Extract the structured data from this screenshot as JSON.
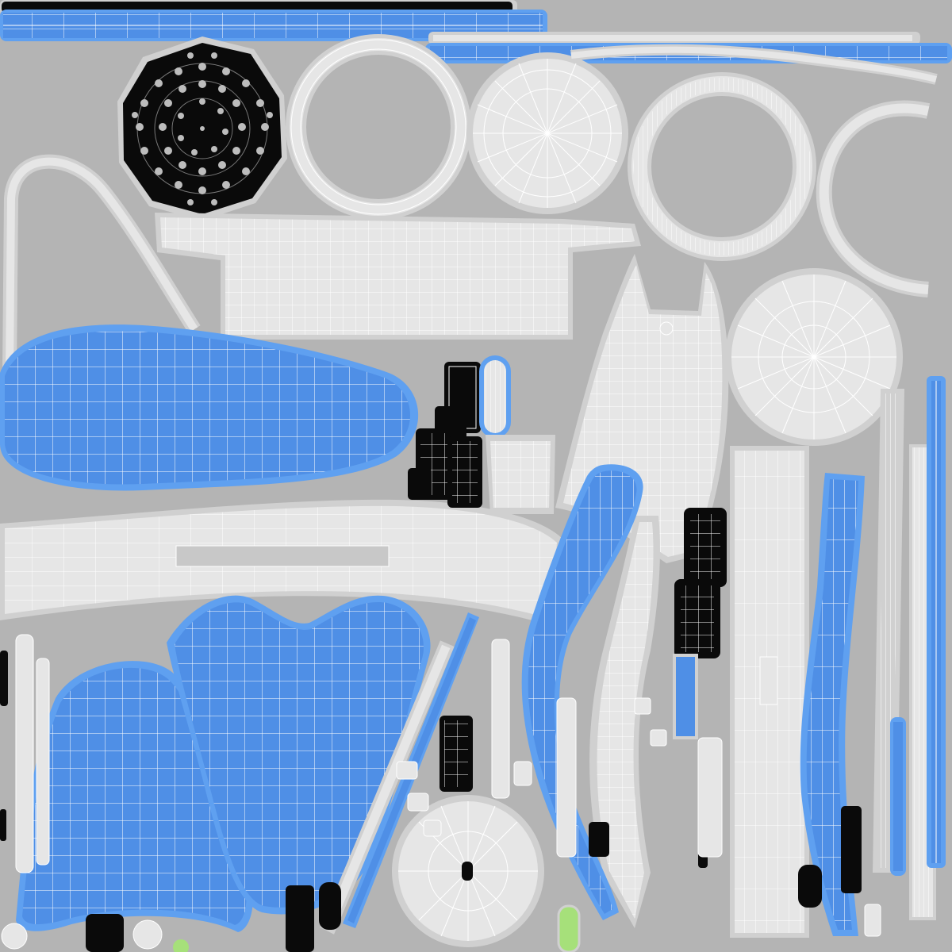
{
  "canvas": {
    "background": "#b4b4b4"
  },
  "palette": {
    "island_fill": "#e6e6e6",
    "island_halo": "#d0d0d0",
    "wire": "#ffffff",
    "blue_fill": "#4f8fe6",
    "blue_halo": "#5fa0f0",
    "black_fill": "#0a0a0a",
    "green_fill": "#a6e07a"
  },
  "uv_islands": [
    "top-strip-black",
    "top-strip-blue",
    "top-right-strip-blue",
    "dotted-disc-black",
    "ring-large",
    "fan-disc",
    "ring-right",
    "arc-right",
    "curved-tube-left",
    "arched-panel",
    "blue-teardrop-panel",
    "arch-band-panel",
    "blue-dress-panel-left",
    "blue-dress-panel-center",
    "blue-long-strip-center",
    "blue-long-strip-right",
    "pointed-panel-center",
    "disc-right",
    "vertical-strips-right",
    "black-components",
    "small-disc-bottom"
  ]
}
